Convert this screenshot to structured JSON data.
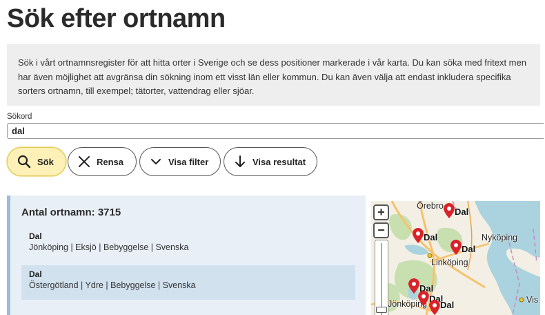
{
  "page": {
    "title": "Sök efter ortnamn",
    "intro": "Sök i vårt ortnamnsregister för att hitta orter i Sverige och se dess positioner markerade i vår karta. Du kan söka med fritext men har även möjlighet att avgränsa din sökning inom ett visst län eller kommun. Du kan även välja att endast inkludera specifika sorters ortnamn, till exempel; tätorter, vattendrag eller sjöar."
  },
  "search": {
    "label": "Sökord",
    "value": "dal"
  },
  "buttons": {
    "search": "Sök",
    "clear": "Rensa",
    "show_filter": "Visa filter",
    "show_results": "Visa resultat"
  },
  "results": {
    "count_label": "Antal ortnamn: 3715",
    "items": [
      {
        "name": "Dal",
        "meta": "Jönköping | Eksjö | Bebyggelse | Svenska"
      },
      {
        "name": "Dal",
        "meta": "Östergötland | Ydre | Bebyggelse | Svenska"
      }
    ]
  },
  "map": {
    "zoom_in": "+",
    "zoom_out": "−",
    "places": [
      "Örebro",
      "Nyköping",
      "Linköping",
      "Jönköping",
      "Vis"
    ],
    "pins": [
      "Dal",
      "Dal",
      "Dal",
      "Dal",
      "Dal",
      "Dal"
    ],
    "colors": {
      "pin": "#d9222a",
      "water": "#aad3df",
      "forest": "#c8dfb0",
      "road": "#f5c26b"
    }
  }
}
